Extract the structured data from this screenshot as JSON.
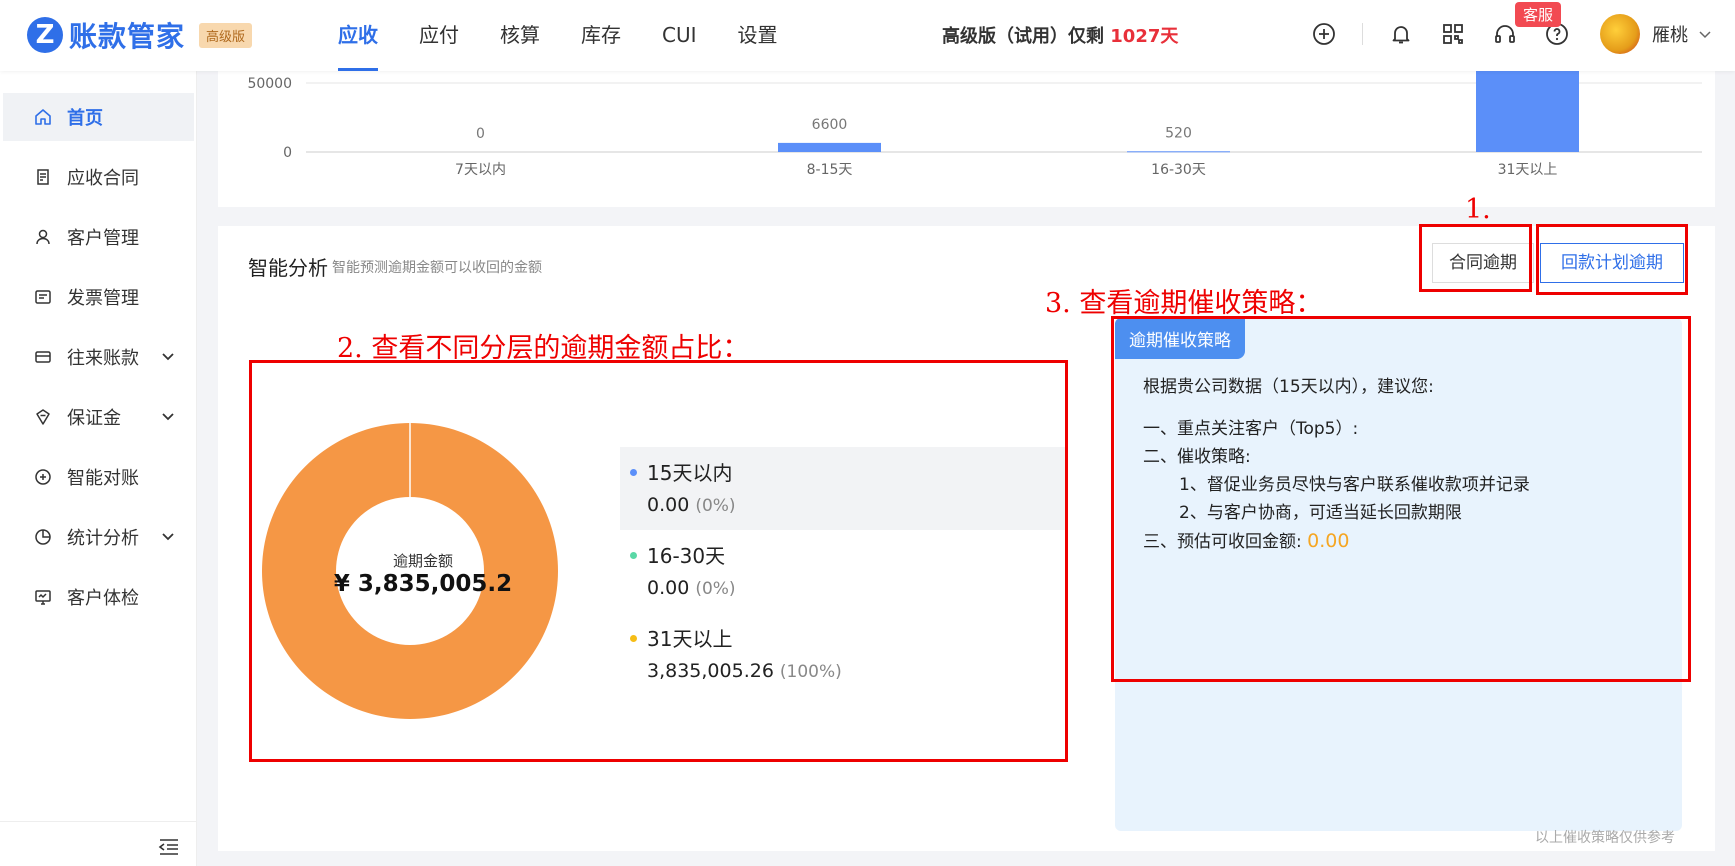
{
  "app": {
    "logo_mark": "Z",
    "name": "账款管家",
    "edition_badge": "高级版"
  },
  "nav": {
    "items": [
      "应收",
      "应付",
      "核算",
      "库存",
      "CUI",
      "设置"
    ],
    "active": "应收"
  },
  "trial": {
    "prefix": "高级版（试用）仅剩 ",
    "days": "1027天"
  },
  "header": {
    "kefu_badge": "客服",
    "username": "雁桃"
  },
  "sidebar": {
    "items": [
      {
        "label": "首页",
        "icon": "home-icon"
      },
      {
        "label": "应收合同",
        "icon": "contract-icon"
      },
      {
        "label": "客户管理",
        "icon": "customer-icon"
      },
      {
        "label": "发票管理",
        "icon": "invoice-icon"
      },
      {
        "label": "往来账款",
        "icon": "account-icon"
      },
      {
        "label": "保证金",
        "icon": "deposit-icon"
      },
      {
        "label": "智能对账",
        "icon": "reconcile-icon"
      },
      {
        "label": "统计分析",
        "icon": "stats-icon"
      },
      {
        "label": "客户体检",
        "icon": "checkup-icon"
      }
    ]
  },
  "chart_data": {
    "type": "bar",
    "categories": [
      "7天以内",
      "8-15天",
      "16-30天",
      "31天以上"
    ],
    "values": [
      0,
      6600,
      520,
      3835005.26
    ],
    "data_labels": [
      "0",
      "6600",
      "520",
      ""
    ],
    "y_ticks": [
      "50000",
      "0"
    ],
    "ylim": [
      0,
      50000
    ],
    "bar_color": "#5b8ff9",
    "note": ""
  },
  "analysis": {
    "title": "智能分析",
    "subtitle": "智能预测逾期金额可以收回的金额",
    "tabs": [
      "合同逾期",
      "回款计划逾期"
    ],
    "donut": {
      "center_label": "逾期金额",
      "center_value": "¥ 3,835,005.2",
      "slices": [
        {
          "name": "15天以内",
          "value": 0,
          "color": "#5b8ff9"
        },
        {
          "name": "16-30天",
          "value": 0,
          "color": "#5ad8a6"
        },
        {
          "name": "31天以上",
          "value": 3835005.26,
          "color": "#f59745"
        }
      ]
    },
    "legend": [
      {
        "name": "15天以内",
        "value": "0.00",
        "pct": "(0%)",
        "color": "#5b8ff9"
      },
      {
        "name": "16-30天",
        "value": "0.00",
        "pct": "(0%)",
        "color": "#5ad8a6"
      },
      {
        "name": "31天以上",
        "value": "3,835,005.26",
        "pct": "(100%)",
        "color": "#f6bd16"
      }
    ],
    "strategy": {
      "tag": "逾期催收策略",
      "intro": "根据贵公司数据（15天以内），建议您:",
      "line1": "一、重点关注客户（Top5）:",
      "line2": "二、催收策略:",
      "line2a": "1、督促业务员尽快与客户联系催收款项并记录",
      "line2b": "2、与客户协商，可适当延长回款期限",
      "line3": "三、预估可收回金额: ",
      "amount": "0.00"
    },
    "footnote": "以上催收策略仅供参考"
  },
  "annotations": {
    "step1": "1.",
    "step2": "2. 查看不同分层的逾期金额占比：",
    "step3": "3. 查看逾期催收策略："
  }
}
